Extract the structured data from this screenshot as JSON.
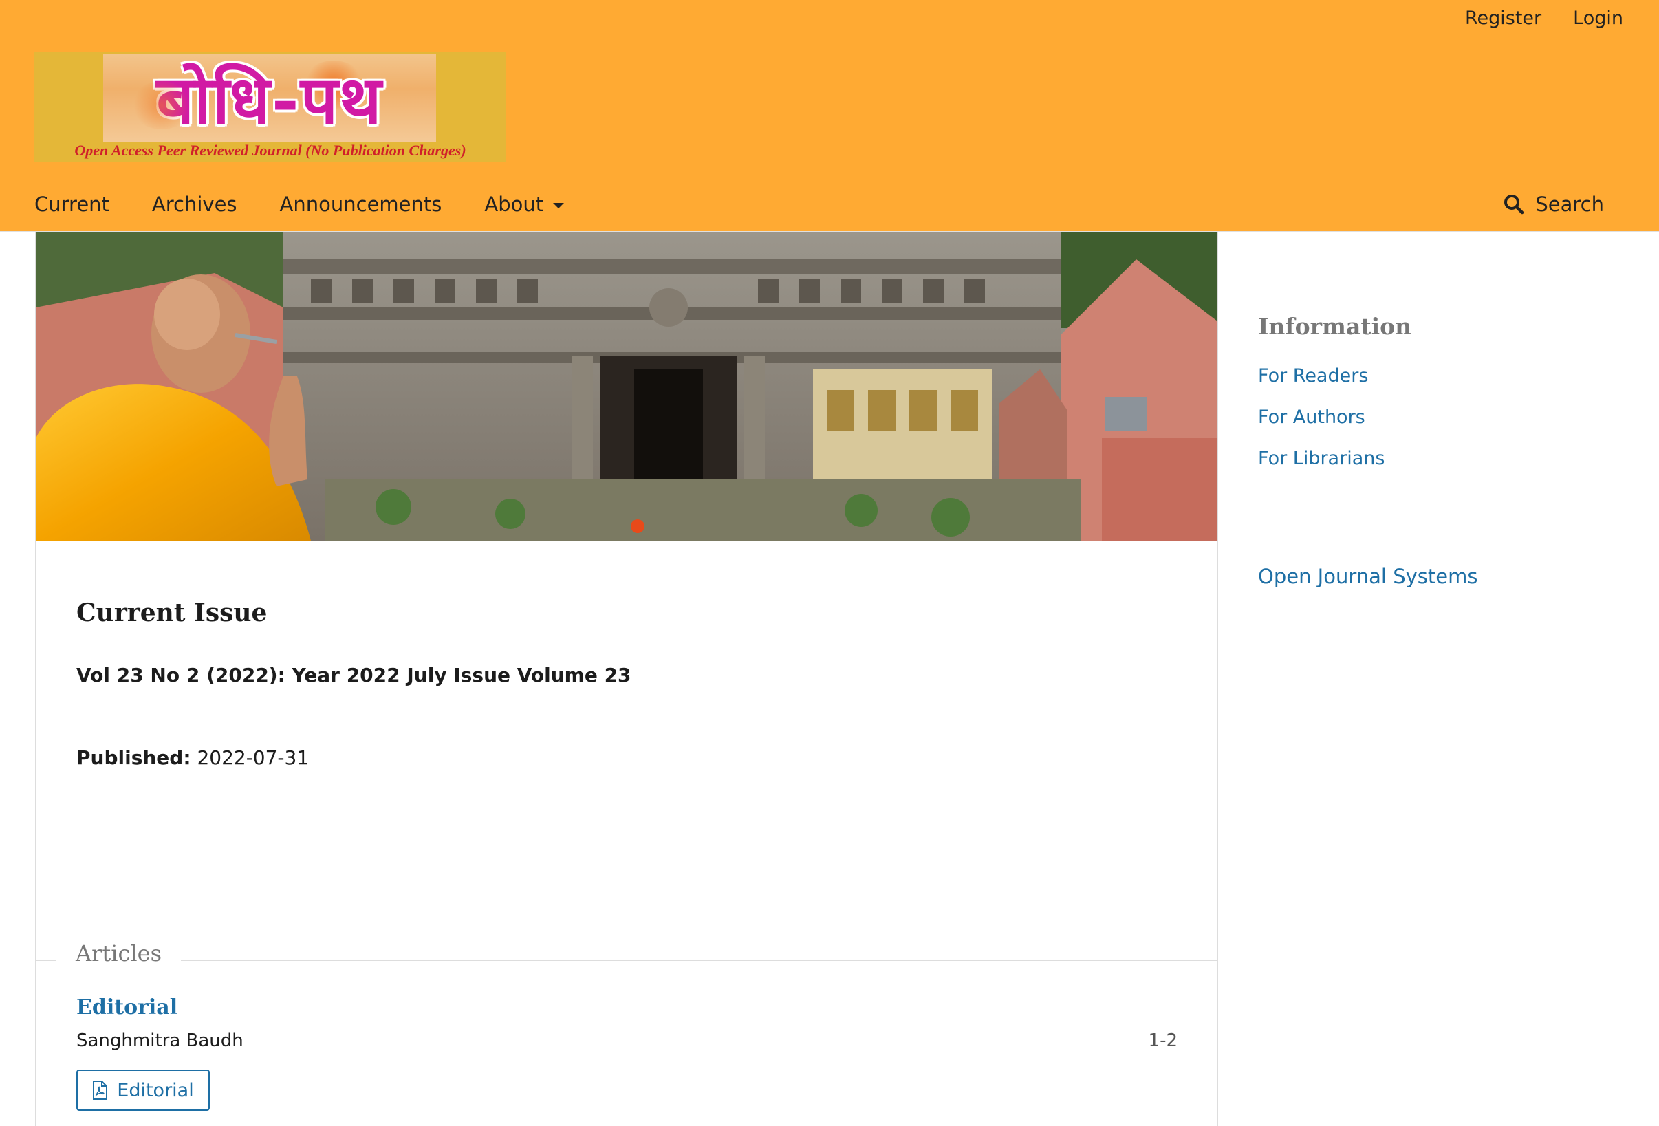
{
  "user_nav": {
    "register": "Register",
    "login": "Login"
  },
  "logo": {
    "script_text": "बोधि-पथ",
    "tagline": "Open Access Peer Reviewed Journal (No Publication Charges)"
  },
  "primary_nav": {
    "items": [
      {
        "label": "Current"
      },
      {
        "label": "Archives"
      },
      {
        "label": "Announcements"
      },
      {
        "label": "About"
      }
    ],
    "search_label": "Search"
  },
  "issue": {
    "heading": "Current Issue",
    "identification": "Vol 23 No 2 (2022): Year 2022 July Issue Volume 23",
    "published_label": "Published:",
    "published_date": "2022-07-31"
  },
  "articles_section": {
    "label": "Articles",
    "items": [
      {
        "title": "Editorial",
        "author": "Sanghmitra Baudh",
        "pages": "1-2",
        "galley_label": "Editorial"
      }
    ]
  },
  "sidebar": {
    "heading": "Information",
    "links": [
      {
        "label": "For Readers"
      },
      {
        "label": "For Authors"
      },
      {
        "label": "For Librarians"
      }
    ],
    "ojs_link": "Open Journal Systems"
  },
  "colors": {
    "header_bg": "#ffaa33",
    "link": "#1e6fa5",
    "text": "#1c1c1c"
  }
}
